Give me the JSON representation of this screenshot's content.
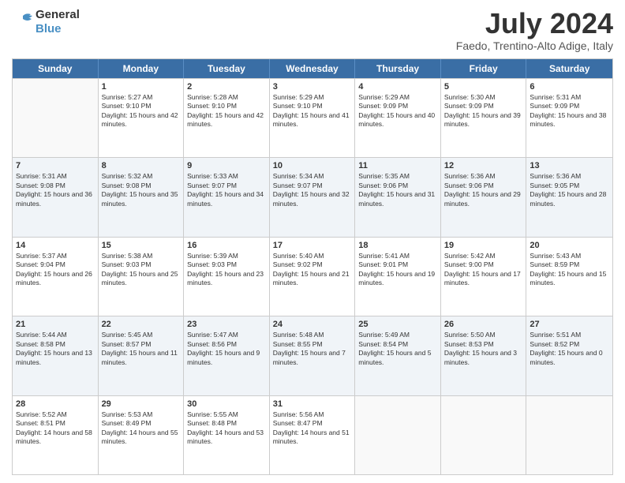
{
  "header": {
    "logo_general": "General",
    "logo_blue": "Blue",
    "title": "July 2024",
    "location": "Faedo, Trentino-Alto Adige, Italy"
  },
  "days": [
    "Sunday",
    "Monday",
    "Tuesday",
    "Wednesday",
    "Thursday",
    "Friday",
    "Saturday"
  ],
  "weeks": [
    [
      {
        "day": "",
        "sunrise": "",
        "sunset": "",
        "daylight": "",
        "empty": true
      },
      {
        "day": "1",
        "sunrise": "Sunrise: 5:27 AM",
        "sunset": "Sunset: 9:10 PM",
        "daylight": "Daylight: 15 hours and 42 minutes."
      },
      {
        "day": "2",
        "sunrise": "Sunrise: 5:28 AM",
        "sunset": "Sunset: 9:10 PM",
        "daylight": "Daylight: 15 hours and 42 minutes."
      },
      {
        "day": "3",
        "sunrise": "Sunrise: 5:29 AM",
        "sunset": "Sunset: 9:10 PM",
        "daylight": "Daylight: 15 hours and 41 minutes."
      },
      {
        "day": "4",
        "sunrise": "Sunrise: 5:29 AM",
        "sunset": "Sunset: 9:09 PM",
        "daylight": "Daylight: 15 hours and 40 minutes."
      },
      {
        "day": "5",
        "sunrise": "Sunrise: 5:30 AM",
        "sunset": "Sunset: 9:09 PM",
        "daylight": "Daylight: 15 hours and 39 minutes."
      },
      {
        "day": "6",
        "sunrise": "Sunrise: 5:31 AM",
        "sunset": "Sunset: 9:09 PM",
        "daylight": "Daylight: 15 hours and 38 minutes."
      }
    ],
    [
      {
        "day": "7",
        "sunrise": "Sunrise: 5:31 AM",
        "sunset": "Sunset: 9:08 PM",
        "daylight": "Daylight: 15 hours and 36 minutes."
      },
      {
        "day": "8",
        "sunrise": "Sunrise: 5:32 AM",
        "sunset": "Sunset: 9:08 PM",
        "daylight": "Daylight: 15 hours and 35 minutes."
      },
      {
        "day": "9",
        "sunrise": "Sunrise: 5:33 AM",
        "sunset": "Sunset: 9:07 PM",
        "daylight": "Daylight: 15 hours and 34 minutes."
      },
      {
        "day": "10",
        "sunrise": "Sunrise: 5:34 AM",
        "sunset": "Sunset: 9:07 PM",
        "daylight": "Daylight: 15 hours and 32 minutes."
      },
      {
        "day": "11",
        "sunrise": "Sunrise: 5:35 AM",
        "sunset": "Sunset: 9:06 PM",
        "daylight": "Daylight: 15 hours and 31 minutes."
      },
      {
        "day": "12",
        "sunrise": "Sunrise: 5:36 AM",
        "sunset": "Sunset: 9:06 PM",
        "daylight": "Daylight: 15 hours and 29 minutes."
      },
      {
        "day": "13",
        "sunrise": "Sunrise: 5:36 AM",
        "sunset": "Sunset: 9:05 PM",
        "daylight": "Daylight: 15 hours and 28 minutes."
      }
    ],
    [
      {
        "day": "14",
        "sunrise": "Sunrise: 5:37 AM",
        "sunset": "Sunset: 9:04 PM",
        "daylight": "Daylight: 15 hours and 26 minutes."
      },
      {
        "day": "15",
        "sunrise": "Sunrise: 5:38 AM",
        "sunset": "Sunset: 9:03 PM",
        "daylight": "Daylight: 15 hours and 25 minutes."
      },
      {
        "day": "16",
        "sunrise": "Sunrise: 5:39 AM",
        "sunset": "Sunset: 9:03 PM",
        "daylight": "Daylight: 15 hours and 23 minutes."
      },
      {
        "day": "17",
        "sunrise": "Sunrise: 5:40 AM",
        "sunset": "Sunset: 9:02 PM",
        "daylight": "Daylight: 15 hours and 21 minutes."
      },
      {
        "day": "18",
        "sunrise": "Sunrise: 5:41 AM",
        "sunset": "Sunset: 9:01 PM",
        "daylight": "Daylight: 15 hours and 19 minutes."
      },
      {
        "day": "19",
        "sunrise": "Sunrise: 5:42 AM",
        "sunset": "Sunset: 9:00 PM",
        "daylight": "Daylight: 15 hours and 17 minutes."
      },
      {
        "day": "20",
        "sunrise": "Sunrise: 5:43 AM",
        "sunset": "Sunset: 8:59 PM",
        "daylight": "Daylight: 15 hours and 15 minutes."
      }
    ],
    [
      {
        "day": "21",
        "sunrise": "Sunrise: 5:44 AM",
        "sunset": "Sunset: 8:58 PM",
        "daylight": "Daylight: 15 hours and 13 minutes."
      },
      {
        "day": "22",
        "sunrise": "Sunrise: 5:45 AM",
        "sunset": "Sunset: 8:57 PM",
        "daylight": "Daylight: 15 hours and 11 minutes."
      },
      {
        "day": "23",
        "sunrise": "Sunrise: 5:47 AM",
        "sunset": "Sunset: 8:56 PM",
        "daylight": "Daylight: 15 hours and 9 minutes."
      },
      {
        "day": "24",
        "sunrise": "Sunrise: 5:48 AM",
        "sunset": "Sunset: 8:55 PM",
        "daylight": "Daylight: 15 hours and 7 minutes."
      },
      {
        "day": "25",
        "sunrise": "Sunrise: 5:49 AM",
        "sunset": "Sunset: 8:54 PM",
        "daylight": "Daylight: 15 hours and 5 minutes."
      },
      {
        "day": "26",
        "sunrise": "Sunrise: 5:50 AM",
        "sunset": "Sunset: 8:53 PM",
        "daylight": "Daylight: 15 hours and 3 minutes."
      },
      {
        "day": "27",
        "sunrise": "Sunrise: 5:51 AM",
        "sunset": "Sunset: 8:52 PM",
        "daylight": "Daylight: 15 hours and 0 minutes."
      }
    ],
    [
      {
        "day": "28",
        "sunrise": "Sunrise: 5:52 AM",
        "sunset": "Sunset: 8:51 PM",
        "daylight": "Daylight: 14 hours and 58 minutes."
      },
      {
        "day": "29",
        "sunrise": "Sunrise: 5:53 AM",
        "sunset": "Sunset: 8:49 PM",
        "daylight": "Daylight: 14 hours and 55 minutes."
      },
      {
        "day": "30",
        "sunrise": "Sunrise: 5:55 AM",
        "sunset": "Sunset: 8:48 PM",
        "daylight": "Daylight: 14 hours and 53 minutes."
      },
      {
        "day": "31",
        "sunrise": "Sunrise: 5:56 AM",
        "sunset": "Sunset: 8:47 PM",
        "daylight": "Daylight: 14 hours and 51 minutes."
      },
      {
        "day": "",
        "sunrise": "",
        "sunset": "",
        "daylight": "",
        "empty": true
      },
      {
        "day": "",
        "sunrise": "",
        "sunset": "",
        "daylight": "",
        "empty": true
      },
      {
        "day": "",
        "sunrise": "",
        "sunset": "",
        "daylight": "",
        "empty": true
      }
    ]
  ]
}
